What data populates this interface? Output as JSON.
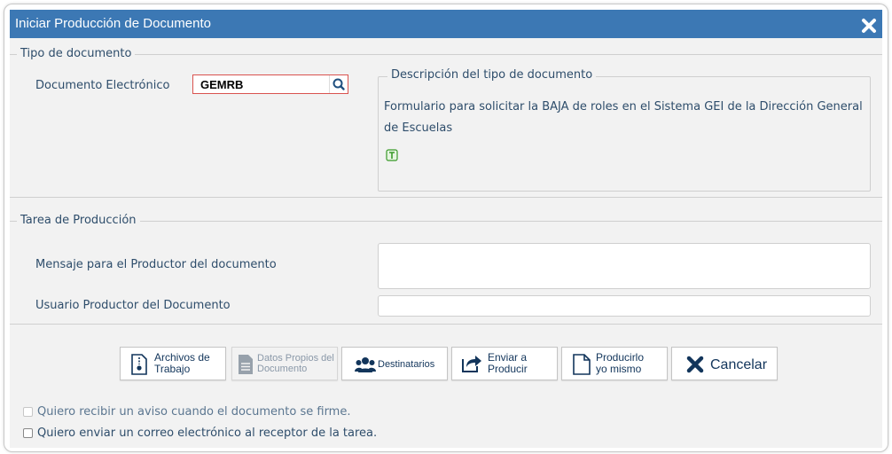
{
  "dialog": {
    "title": "Iniciar Producción de Documento"
  },
  "tipo_documento": {
    "legend": "Tipo de documento",
    "doc_label": "Documento Electrónico",
    "doc_value": "GEMRB",
    "descripcion": {
      "legend": "Descripción del tipo de documento",
      "text": "Formulario para solicitar la BAJA de roles en el Sistema GEI de la Dirección General de Escuelas"
    }
  },
  "tarea_produccion": {
    "legend": "Tarea de Producción",
    "mensaje_label": "Mensaje para el Productor del documento",
    "mensaje_value": "",
    "usuario_label": "Usuario Productor del Documento",
    "usuario_value": ""
  },
  "buttons": {
    "archivos": {
      "line1": "Archivos de",
      "line2": "Trabajo"
    },
    "datos": {
      "line1": "Datos Propios del",
      "line2": "Documento"
    },
    "destinatarios": {
      "label": "Destinatarios"
    },
    "enviar": {
      "line1": "Enviar a",
      "line2": "Producir"
    },
    "producirlo": {
      "line1": "Producirlo",
      "line2": "yo mismo"
    },
    "cancelar": {
      "label": "Cancelar"
    }
  },
  "checkboxes": {
    "aviso_firma": "Quiero recibir un aviso cuando el documento se firme.",
    "correo_receptor": "Quiero enviar un correo electrónico al receptor de la tarea."
  },
  "colors": {
    "title_bar": "#3c78b4",
    "body_bg": "#f2f2f2",
    "text": "#2e4d6b",
    "input_error_border": "#d9534f",
    "cancel_icon": "#12355b"
  },
  "icons": {
    "close": "close-icon",
    "search": "search-icon",
    "template": "template-icon",
    "archivos": "zip-file-icon",
    "datos": "document-lines-icon",
    "destinatarios": "group-users-icon",
    "enviar": "share-arrow-icon",
    "producirlo": "blank-document-icon",
    "cancelar": "x-icon"
  }
}
